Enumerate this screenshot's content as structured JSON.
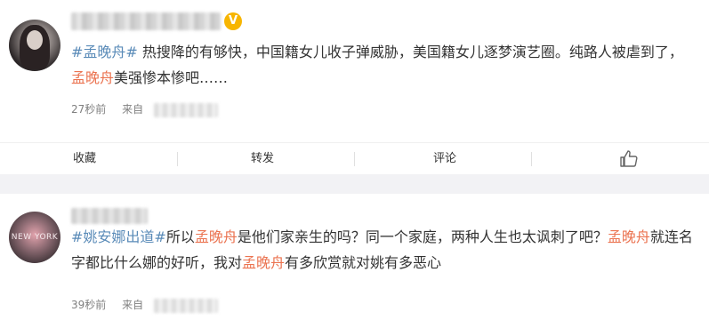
{
  "posts": [
    {
      "avatar_icon": "user-avatar",
      "badge": "V",
      "content": {
        "tag1": "#孟晚舟#",
        "text1": " 热搜降的有够快，中国籍女儿收子弹威胁，美国籍女儿逐梦演艺圈。纯路人被虐到了，",
        "name": "孟晚舟",
        "text2": "美强惨本惨吧……"
      },
      "time": "27秒前",
      "source_label": "来自",
      "actions": {
        "favorite": "收藏",
        "repost": "转发",
        "comment": "评论",
        "like_icon": "thumbs-up-icon"
      }
    },
    {
      "avatar_icon": "user-avatar",
      "avatar_text": "NEW YORK",
      "content": {
        "tag1": "#姚安娜出道#",
        "text1": "所以",
        "name1": "孟晚舟",
        "text2": "是他们家亲生的吗？同一个家庭，两种人生也太讽刺了吧？",
        "name2": "孟晚舟",
        "text3": "就连名字都比什么娜的好听，我对",
        "name3": "孟晚舟",
        "text4": "有多欣赏就对姚有多恶心"
      },
      "time": "39秒前",
      "source_label": "来自"
    }
  ],
  "colors": {
    "highlight": "#eb7350",
    "link": "#5a8bb8",
    "text": "#333333",
    "meta": "#808080",
    "badge": "#f7b500",
    "separator_band": "#f2f2f5"
  }
}
